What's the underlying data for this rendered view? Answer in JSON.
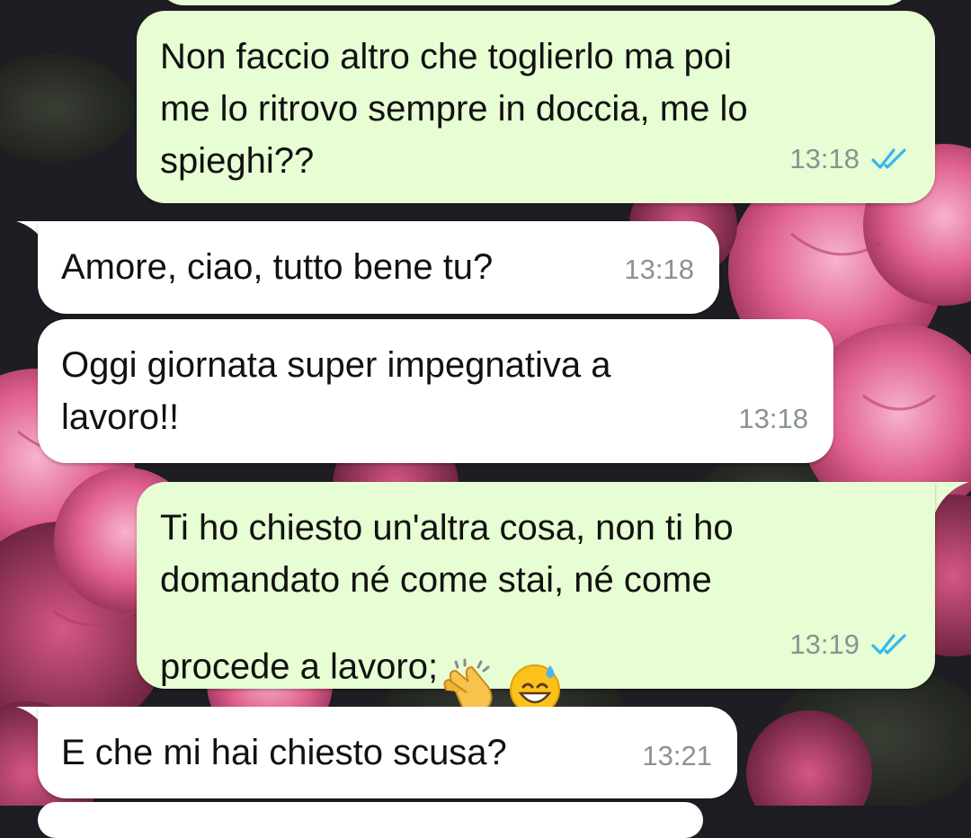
{
  "theme": {
    "outgoing_bg": "#e7fdd3",
    "incoming_bg": "#ffffff",
    "tick_color": "#34b7f1",
    "time_color": "#8a938f"
  },
  "messages": [
    {
      "direction": "outgoing",
      "text": "Non faccio altro che toglierlo ma poi\nme lo ritrovo sempre in doccia, me lo\nspieghi??",
      "time": "13:18",
      "status": "read-double-check"
    },
    {
      "direction": "incoming",
      "text": "Amore, ciao, tutto bene tu?",
      "time": "13:18"
    },
    {
      "direction": "incoming",
      "text": "Oggi giornata super impegnativa a\nlavoro!!",
      "time": "13:18"
    },
    {
      "direction": "outgoing",
      "text": "Ti ho chiesto un'altra cosa, non ti ho\ndomandato né come stai, né come\nprocede a lavoro;",
      "emojis": [
        "clapping-hands-emoji",
        "grinning-sweat-emoji"
      ],
      "time": "13:19",
      "status": "read-double-check"
    },
    {
      "direction": "incoming",
      "text": "E che mi hai chiesto scusa?",
      "time": "13:21"
    }
  ]
}
